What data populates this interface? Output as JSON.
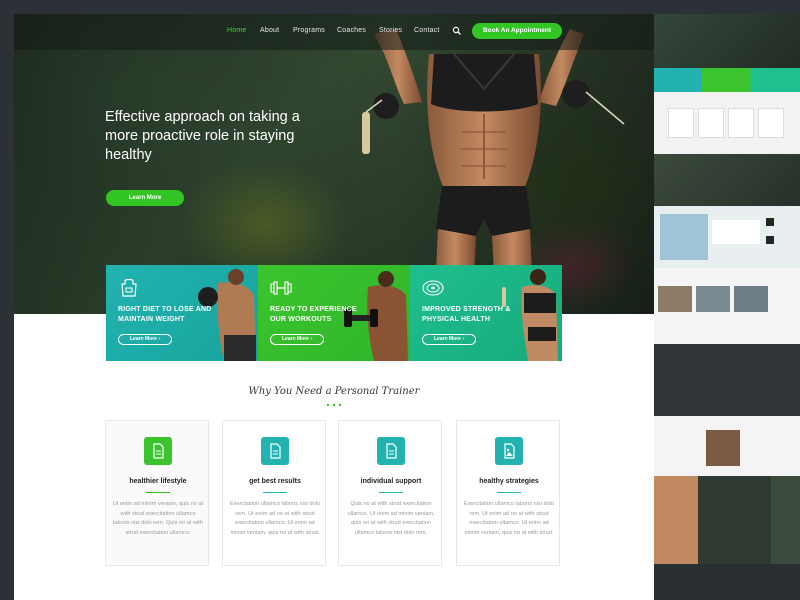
{
  "nav": {
    "items": [
      "Home",
      "About",
      "Programs",
      "Coaches",
      "Stories",
      "Contact"
    ],
    "active_index": 0,
    "appointment_label": "Book An Appointment"
  },
  "hero": {
    "title": "Effective approach on taking a more proactive role in staying healthy",
    "button_label": "Learn More"
  },
  "features": [
    {
      "label": "RIGHT DIET TO LOSE AND MAINTAIN WEIGHT",
      "button": "Learn More",
      "icon": "apron-icon",
      "color": "#22b3b0"
    },
    {
      "label": "READY TO EXPERIENCE OUR WORKOUTS",
      "button": "Learn More",
      "icon": "dumbbell-icon",
      "color": "#3cc42e"
    },
    {
      "label": "IMPROVED STRENGTH & PHYSICAL HEALTH",
      "button": "Learn More",
      "icon": "weight-plate-icon",
      "color": "#1fbf8f"
    }
  ],
  "why": {
    "title": "Why You Need a Personal Trainer"
  },
  "benefits": [
    {
      "title": "healthier lifestyle",
      "text": "Ut enim ad minim veniam, quis no at with strud exercitation ullamco laboris nisi dolo rem. Quis no at with strud exercitation ullamco.",
      "color": "#3cc42e"
    },
    {
      "title": "get best results",
      "text": "Exercitation ullamco laboris nisi dolo rem. Ut enim ad no at with strud exercitation ullamco. Ut enim ad minim veniam, quis no at with strud.",
      "color": "#22b3b0"
    },
    {
      "title": "individual support",
      "text": "Quis no at with strud exercitation ullamco. Ut enim ad minim veniam, quis no at with strud exercitation ullamco laboris nisi dolo rem.",
      "color": "#22b3b0"
    },
    {
      "title": "healthy strategies",
      "text": "Exercitation ullamco laboris nisi dolo rem. Ut enim ad no at with strud exercitation ullamco. Ut enim ad minim veniam, quis no at with strud.",
      "color": "#22b3b0"
    }
  ],
  "colors": {
    "accent_green": "#33c524",
    "teal": "#22b3b0",
    "sea_green": "#1fbf8f",
    "page_bg": "#2c3138"
  }
}
